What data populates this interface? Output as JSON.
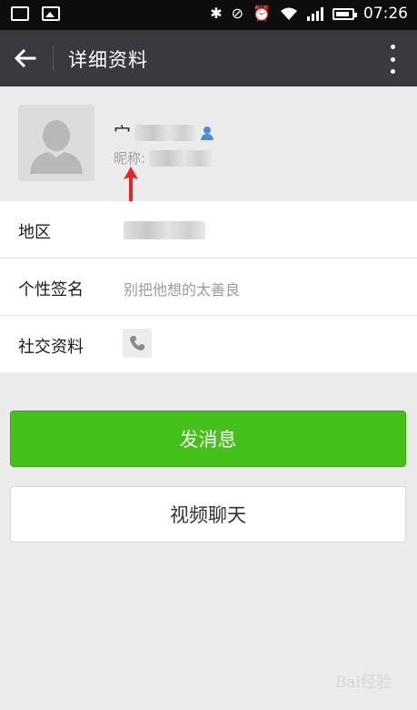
{
  "status_bar": {
    "time": "07:26",
    "icons": [
      "notification-icon",
      "image-icon",
      "bluetooth-icon",
      "mute-icon",
      "alarm-icon",
      "wifi-icon",
      "signal-icon",
      "battery-icon"
    ]
  },
  "app_bar": {
    "title": "详细资料",
    "back_icon": "arrow-left-icon",
    "more_icon": "more-vertical-icon"
  },
  "profile": {
    "name_visible_char": "宀",
    "nickname_label": "昵称:",
    "annotation": "red-arrow-up"
  },
  "rows": [
    {
      "label": "地区",
      "value": ""
    },
    {
      "label": "个性签名",
      "value": "别把他想的太善良"
    },
    {
      "label": "社交资料",
      "value": ""
    }
  ],
  "actions": {
    "send_message": "发消息",
    "video_chat": "视频聊天"
  },
  "colors": {
    "primary_green": "#45c01a",
    "app_bar": "#393a3f",
    "background": "#ebebeb"
  },
  "watermark": "Bai经验"
}
